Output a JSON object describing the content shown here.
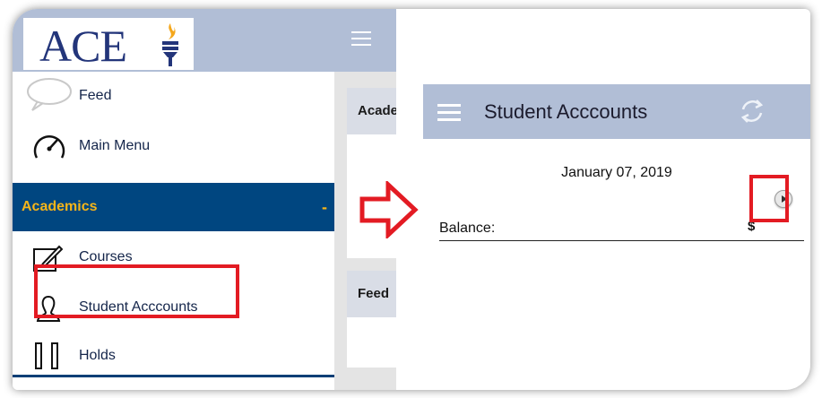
{
  "left_screen": {
    "logo_text": "ACE",
    "menu": {
      "items": [
        {
          "label": "Feed",
          "icon": "speech-bubble-icon"
        },
        {
          "label": "Main Menu",
          "icon": "speedometer-icon"
        }
      ],
      "section": {
        "label": "Academics",
        "toggle": "-"
      },
      "sub_items": [
        {
          "label": "Courses",
          "icon": "edit-icon"
        },
        {
          "label": "Student Acccounts",
          "icon": "person-icon"
        },
        {
          "label": "Holds",
          "icon": "pause-icon"
        }
      ]
    },
    "background_cards": [
      {
        "title": "Acade"
      },
      {
        "title": "Feed"
      }
    ]
  },
  "right_screen": {
    "title": "Student Acccounts",
    "date": "January 07, 2019",
    "balance_label": "Balance:",
    "balance_value": "$"
  },
  "colors": {
    "header_bg": "#b1bed6",
    "academics_bg": "#004680",
    "academics_text": "#f6b519",
    "logo_text": "#23357a",
    "highlight": "#e31b23"
  }
}
